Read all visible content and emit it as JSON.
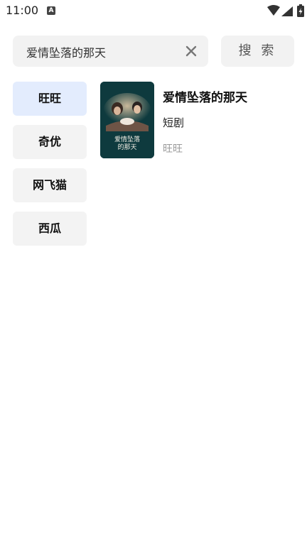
{
  "status_bar": {
    "time": "11:00",
    "notification_badge": "A"
  },
  "search": {
    "value": "爱情坠落的那天",
    "button_label": "搜 索"
  },
  "sources": [
    {
      "label": "旺旺",
      "active": true
    },
    {
      "label": "奇优",
      "active": false
    },
    {
      "label": "网飞猫",
      "active": false
    },
    {
      "label": "西瓜",
      "active": false
    }
  ],
  "results": [
    {
      "title": "爱情坠落的那天",
      "type": "短剧",
      "source": "旺旺",
      "poster_caption": "爱情坠落\n的那天"
    }
  ],
  "colors": {
    "active_source_bg": "#e3ecfd",
    "inactive_bg": "#f3f3f3",
    "muted_text": "#9a9a9a"
  }
}
